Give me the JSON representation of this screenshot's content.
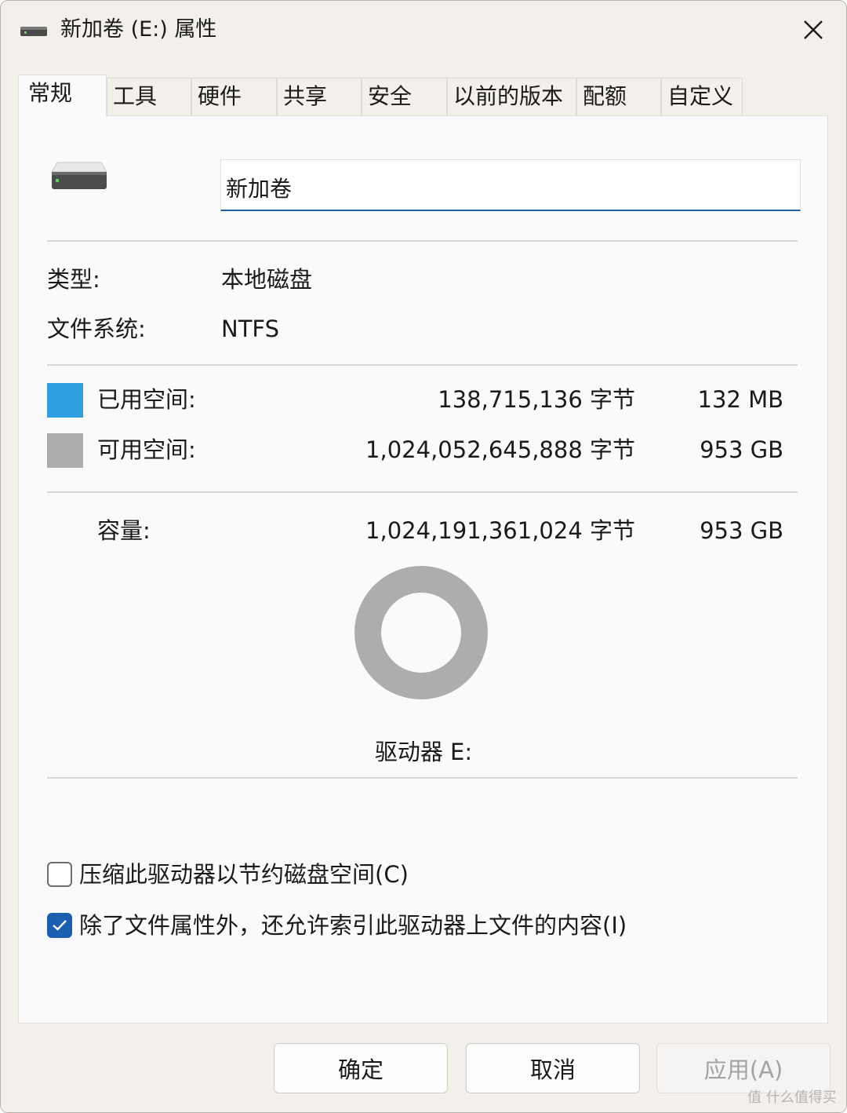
{
  "window": {
    "title": "新加卷 (E:) 属性",
    "close_icon": "close-icon"
  },
  "tabs": [
    {
      "label": "常规",
      "active": true
    },
    {
      "label": "工具"
    },
    {
      "label": "硬件"
    },
    {
      "label": "共享"
    },
    {
      "label": "安全"
    },
    {
      "label": "以前的版本"
    },
    {
      "label": "配额"
    },
    {
      "label": "自定义"
    }
  ],
  "general": {
    "volume_name": "新加卷",
    "type_label": "类型:",
    "type_value": "本地磁盘",
    "fs_label": "文件系统:",
    "fs_value": "NTFS",
    "used": {
      "label": "已用空间:",
      "bytes": "138,715,136 字节",
      "size": "132 MB",
      "color": "#2f9ee0"
    },
    "free": {
      "label": "可用空间:",
      "bytes": "1,024,052,645,888 字节",
      "size": "953 GB",
      "color": "#adadad"
    },
    "capacity": {
      "label": "容量:",
      "bytes": "1,024,191,361,024 字节",
      "size": "953 GB"
    },
    "usage_fraction_used": 0.000135,
    "drive_label": "驱动器 E:",
    "compress": {
      "label": "压缩此驱动器以节约磁盘空间(C)",
      "checked": false
    },
    "index": {
      "label": "除了文件属性外，还允许索引此驱动器上文件的内容(I)",
      "checked": true
    }
  },
  "buttons": {
    "ok": "确定",
    "cancel": "取消",
    "apply": "应用(A)"
  },
  "watermark": "值 什么值得买"
}
